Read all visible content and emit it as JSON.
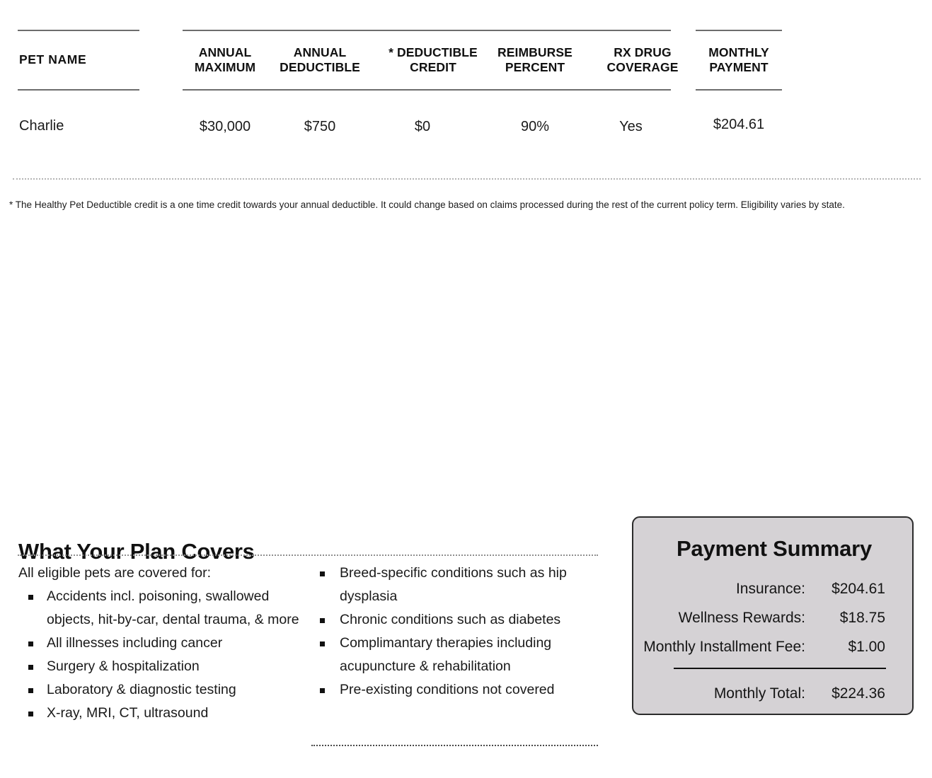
{
  "plan_table": {
    "columns": [
      {
        "key": "pet_name",
        "label": "PET NAME"
      },
      {
        "key": "annual_maximum",
        "label": "ANNUAL\nMAXIMUM",
        "line1": "ANNUAL",
        "line2": "MAXIMUM"
      },
      {
        "key": "annual_deductible",
        "label": "ANNUAL\nDEDUCTIBLE",
        "line1": "ANNUAL",
        "line2": "DEDUCTIBLE"
      },
      {
        "key": "deductible_credit",
        "label": "* DEDUCTIBLE\nCREDIT",
        "line1": "* DEDUCTIBLE",
        "line2": "CREDIT"
      },
      {
        "key": "reimburse_percent",
        "label": "REIMBURSE\nPERCENT",
        "line1": "REIMBURSE",
        "line2": "PERCENT"
      },
      {
        "key": "rx_drug_coverage",
        "label": "RX DRUG\nCOVERAGE",
        "line1": "RX DRUG",
        "line2": "COVERAGE"
      },
      {
        "key": "monthly_payment",
        "label": "MONTHLY\nPAYMENT",
        "line1": "MONTHLY",
        "line2": "PAYMENT"
      }
    ],
    "rows": [
      {
        "pet_name": "Charlie",
        "annual_maximum": "$30,000",
        "annual_deductible": "$750",
        "deductible_credit": "$0",
        "reimburse_percent": "90%",
        "rx_drug_coverage": "Yes",
        "monthly_payment": "$204.61"
      }
    ],
    "footnote": "* The Healthy Pet Deductible credit is a one time credit towards your annual deductible. It could change based on claims processed during the rest of the current policy term. Eligibility varies by state."
  },
  "covers": {
    "title": "What Your Plan Covers",
    "intro": "All eligible pets are covered for:",
    "left_bullets": [
      "Accidents incl. poisoning, swallowed objects, hit-by-car, dental trauma, & more",
      "All illnesses including cancer",
      "Surgery & hospitalization",
      "Laboratory & diagnostic testing",
      "X-ray, MRI, CT, ultrasound"
    ],
    "right_bullets": [
      "Breed-specific conditions such as hip dysplasia",
      "Chronic conditions such as diabetes",
      "Complimantary therapies including acupuncture & rehabilitation",
      "Pre-existing conditions not covered"
    ]
  },
  "payment_summary": {
    "title": "Payment Summary",
    "rows": [
      {
        "label": "Insurance:",
        "value": "$204.61"
      },
      {
        "label": "Wellness Rewards:",
        "value": "$18.75"
      },
      {
        "label": "Monthly Installment Fee:",
        "value": "$1.00"
      }
    ],
    "total": {
      "label": "Monthly Total:",
      "value": "$224.36"
    }
  },
  "colors": {
    "page_background": "#ffffff",
    "text": "#1a1a1a",
    "rule": "#6d6d6d",
    "dotted_rule": "#b4b4b4",
    "summary_background": "#d5d2d5",
    "summary_border": "#2b2b2b"
  }
}
